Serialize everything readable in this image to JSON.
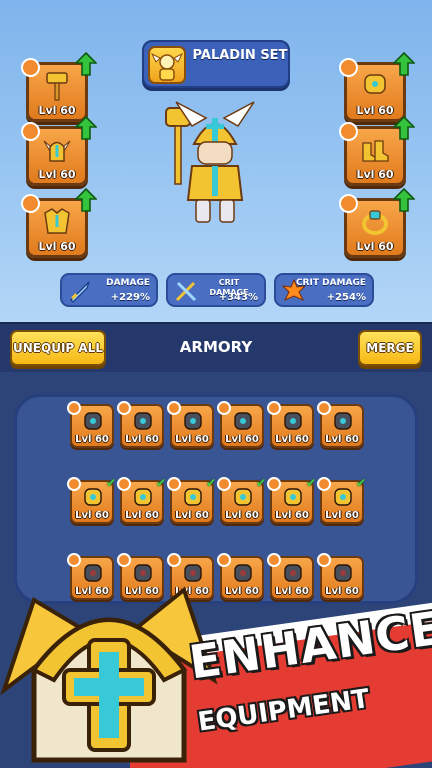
{
  "set_banner": {
    "title": "PALADIN SET",
    "portrait_icon": "paladin-portrait-icon"
  },
  "left_slots": [
    {
      "icon": "hammer-icon",
      "level": "Lvl 60"
    },
    {
      "icon": "winged-helmet-icon",
      "level": "Lvl 60"
    },
    {
      "icon": "chest-armor-icon",
      "level": "Lvl 60"
    }
  ],
  "right_slots": [
    {
      "icon": "gauntlet-icon",
      "level": "Lvl 60"
    },
    {
      "icon": "boots-icon",
      "level": "Lvl 60"
    },
    {
      "icon": "ring-icon",
      "level": "Lvl 60"
    }
  ],
  "stats": [
    {
      "name": "DAMAGE",
      "value": "+229%",
      "icon": "sword-icon"
    },
    {
      "name": "CRIT DAMAGE",
      "value": "+343%",
      "icon": "crit-swords-icon"
    },
    {
      "name": "CRIT DAMAGE",
      "value": "+254%",
      "icon": "burst-icon"
    }
  ],
  "armory": {
    "unequip_label": "UNEQUIP ALL",
    "title": "ARMORY",
    "merge_label": "MERGE"
  },
  "inventory": {
    "rows": [
      [
        {
          "icon": "scythe-icon",
          "level": "Lvl 60",
          "equipped": false
        },
        {
          "icon": "dark-helmet-icon",
          "level": "Lvl 60",
          "equipped": false
        },
        {
          "icon": "dark-armor-icon",
          "level": "Lvl 60",
          "equipped": false
        },
        {
          "icon": "dark-gauntlet-icon",
          "level": "Lvl 60",
          "equipped": false
        },
        {
          "icon": "dark-boots-icon",
          "level": "Lvl 60",
          "equipped": false
        },
        {
          "icon": "dark-ring-icon",
          "level": "Lvl 60",
          "equipped": false
        }
      ],
      [
        {
          "icon": "hammer-icon",
          "level": "Lvl 60",
          "equipped": true
        },
        {
          "icon": "winged-helmet-icon",
          "level": "Lvl 60",
          "equipped": true
        },
        {
          "icon": "chest-armor-icon",
          "level": "Lvl 60",
          "equipped": true
        },
        {
          "icon": "gauntlet-icon",
          "level": "Lvl 60",
          "equipped": true
        },
        {
          "icon": "boots-icon",
          "level": "Lvl 60",
          "equipped": true
        },
        {
          "icon": "ring-icon",
          "level": "Lvl 60",
          "equipped": true
        }
      ],
      [
        {
          "icon": "bow-icon",
          "level": "Lvl 60",
          "equipped": false
        },
        {
          "icon": "hood-icon",
          "level": "Lvl 60",
          "equipped": false
        },
        {
          "icon": "leather-armor-icon",
          "level": "Lvl 60",
          "equipped": false
        },
        {
          "icon": "leather-gauntlet-icon",
          "level": "Lvl 60",
          "equipped": false
        },
        {
          "icon": "leather-boots-icon",
          "level": "Lvl 60",
          "equipped": false
        },
        {
          "icon": "amethyst-ring-icon",
          "level": "Lvl 60",
          "equipped": false
        }
      ]
    ]
  },
  "promo": {
    "line1": "ENHANCE",
    "line2": "EQUIPMENT"
  },
  "colors": {
    "slot_orange": "#f09035",
    "panel_blue": "#3a5594",
    "button_yellow": "#f6c21c",
    "upgrade_green": "#35c23c",
    "promo_red": "#e43b32"
  }
}
